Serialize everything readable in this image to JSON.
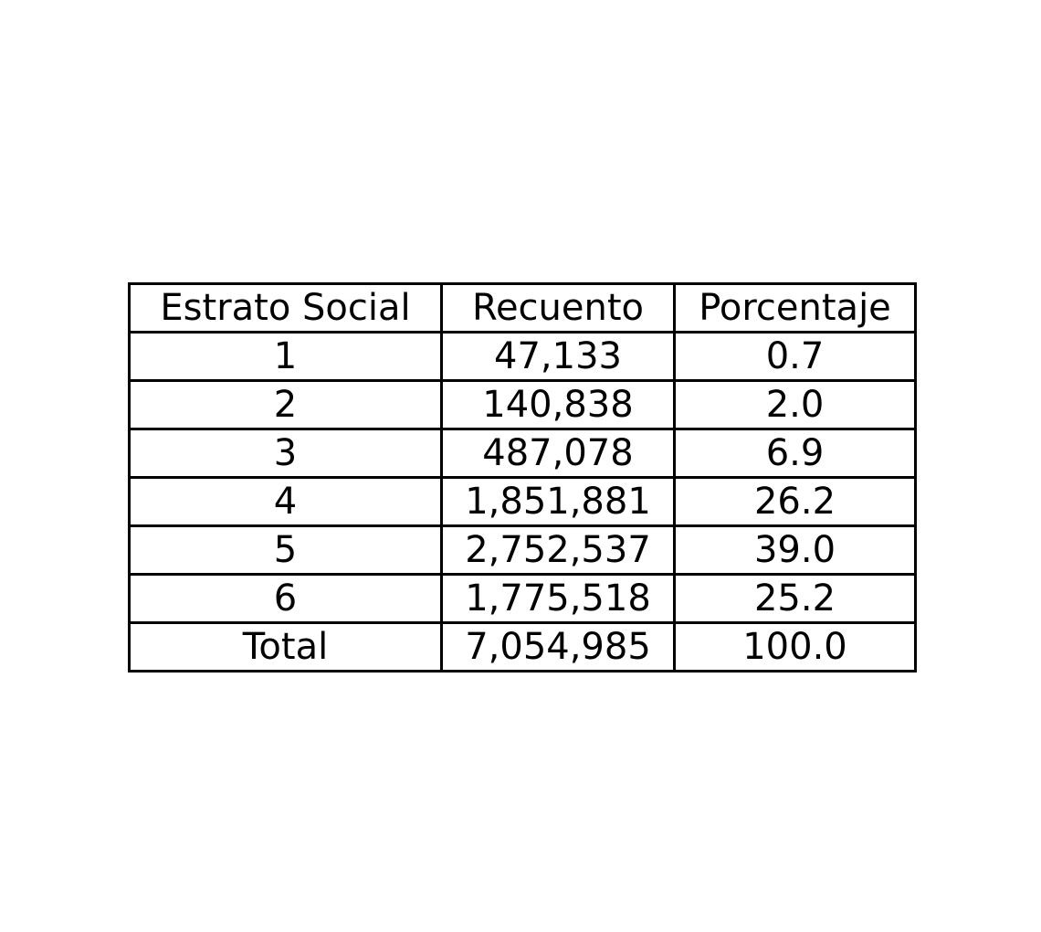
{
  "chart_data": {
    "type": "table",
    "columns": [
      "Estrato Social",
      "Recuento",
      "Porcentaje"
    ],
    "rows": [
      [
        "1",
        "47,133",
        "0.7"
      ],
      [
        "2",
        "140,838",
        "2.0"
      ],
      [
        "3",
        "487,078",
        "6.9"
      ],
      [
        "4",
        "1,851,881",
        "26.2"
      ],
      [
        "5",
        "2,752,537",
        "39.0"
      ],
      [
        "6",
        "1,775,518",
        "25.2"
      ],
      [
        "Total",
        "7,054,985",
        "100.0"
      ]
    ]
  }
}
